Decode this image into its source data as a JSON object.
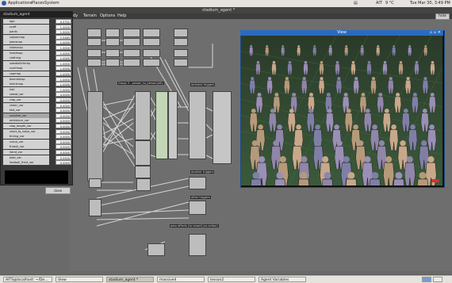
{
  "top_panel": {
    "menus": [
      "Applications",
      "Places",
      "System"
    ],
    "status": "AIT",
    "weather": "9 °C",
    "datetime": "Tue Mar 30, 3:49 PM"
  },
  "main_window": {
    "title": "stadium_agent *",
    "menus": [
      "ody",
      "Terrain",
      "Options",
      "Help"
    ],
    "hide_label": "hide"
  },
  "agent_panel": {
    "title": "stadium_agent",
    "rows": [
      {
        "label": "age",
        "value": "0.5751"
      },
      {
        "label": "scaff",
        "value": "1.0000"
      },
      {
        "label": "pants",
        "value": "1.0000"
      },
      {
        "label": "capsonnap",
        "value": "2.5485"
      },
      {
        "label": "jeansnap",
        "value": "1.0000"
      },
      {
        "label": "shoesnap",
        "value": "1.0000"
      },
      {
        "label": "headmap",
        "value": "1.0000"
      },
      {
        "label": "clothing",
        "value": "1.0000"
      },
      {
        "label": "sweatshirtmap",
        "value": "1.0000"
      },
      {
        "label": "scarfmap",
        "value": "1.0000"
      },
      {
        "label": "capmap",
        "value": "1.0000"
      },
      {
        "label": "beaniemap",
        "value": "1.0000"
      },
      {
        "label": "tshirtmap",
        "value": "1.0000"
      },
      {
        "label": "hair",
        "value": "1.0000"
      },
      {
        "label": "sweat_var",
        "value": "0.0000"
      },
      {
        "label": "clap_var",
        "value": "0.0000"
      },
      {
        "label": "cheer_var",
        "value": "0.0000"
      },
      {
        "label": "fwd_var",
        "value": "0.0000"
      },
      {
        "label": "surprise_var",
        "value": "0.0000"
      },
      {
        "label": "ambience_var",
        "value": "0.0000"
      },
      {
        "label": "clap_length_var",
        "value": "0.0000"
      },
      {
        "label": "react_to_noise_var",
        "value": "0.0000"
      },
      {
        "label": "timing_var",
        "value": "0.0000"
      },
      {
        "label": "crane_var",
        "value": "0.0000"
      },
      {
        "label": "thrash_var",
        "value": "0.0000"
      },
      {
        "label": "hand_var",
        "value": "0.0000"
      },
      {
        "label": "take_var",
        "value": "0.5500"
      },
      {
        "label": "football_third_var",
        "value": "0.0000"
      }
    ],
    "close_label": "close"
  },
  "graph": {
    "labels": [
      "Group 3 - person_to_person(sth)",
      "ambient triggers",
      "another triggers",
      "other triggers",
      "pass effects (to crowd) (as action)"
    ]
  },
  "view_window": {
    "title": "View"
  },
  "taskbar": {
    "tasks": [
      "AITS@localhost: ~/De...",
      "View",
      "stadium_agent *",
      "massive4",
      "lesson2",
      "Agent Variables"
    ]
  },
  "colors": {
    "view_title": "#2a6bc0",
    "panel_bg": "#3a3a3a",
    "node_bg": "#bdbdbd"
  }
}
